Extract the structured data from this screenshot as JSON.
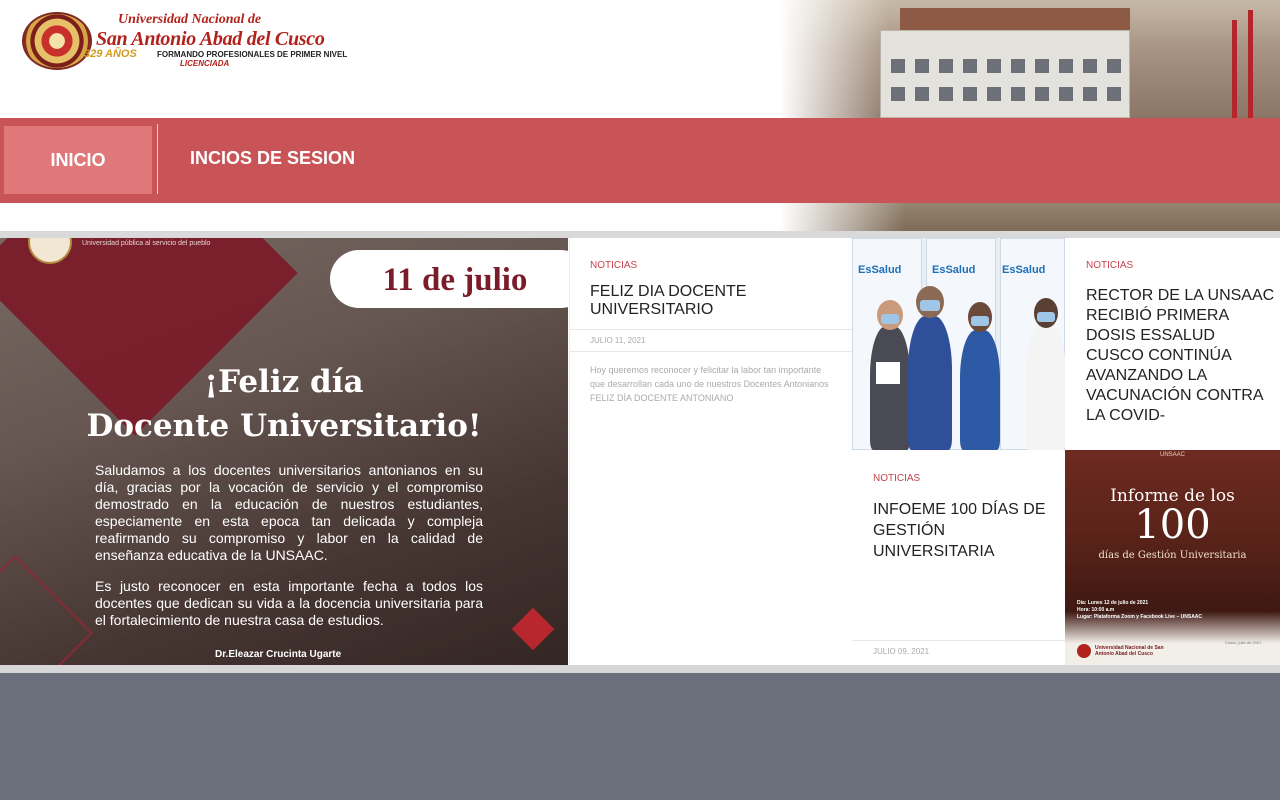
{
  "header": {
    "logo_line1": "Universidad Nacional de",
    "logo_line2": "San Antonio Abad del Cusco",
    "logo_years": "329 AÑOS",
    "logo_tagline": "FORMANDO PROFESIONALES DE PRIMER NIVEL",
    "logo_status": "LICENCIADA"
  },
  "nav": {
    "items": [
      {
        "label": "INICIO"
      },
      {
        "label": "INCIOS DE SESION"
      }
    ]
  },
  "poster": {
    "university_tag": "Universidad pública al servicio del pueblo",
    "date": "11 de julio",
    "heading_line1": "¡Feliz día",
    "heading_line2": "Docente Universitario!",
    "paragraph1": "Saludamos a los docentes universitarios antonianos en su día, gracias por la vocación de servicio y el compromiso demostrado en la educación de nuestros estudiantes, especiamente en esta epoca tan delicada y compleja reafirmando su compromiso y labor en la calidad de enseñanza educativa de la UNSAAC.",
    "paragraph2": "Es justo reconocer en esta importante fecha a todos los docentes que dedican su vida a la docencia universitaria para el fortalecimiento de nuestra casa de estudios.",
    "signature": "Dr.Eleazar Crucinta Ugarte"
  },
  "news": [
    {
      "category": "NOTICIAS",
      "title": "FELIZ DIA DOCENTE UNIVERSITARIO",
      "date": "JULIO 11, 2021",
      "excerpt": "Hoy queremos reconocer y felicitar la labor tan importante que desarrollan cada uno de nuestros Docentes Antonianos   FELIZ DÍA DOCENTE ANTONIANO"
    },
    {
      "category": "NOTICIAS",
      "title": "RECTOR DE LA UNSAAC RECIBIÓ PRIMERA DOSIS ESSALUD CUSCO CONTINÚA AVANZANDO LA VACUNACIÓN CONTRA LA COVID-"
    },
    {
      "category": "NOTICIAS",
      "title": "INFOEME 100 DÍAS DE GESTIÓN UNIVERSITARIA",
      "date": "JULIO 09, 2021"
    }
  ],
  "photo": {
    "banner_text": "EsSalud"
  },
  "informe": {
    "top": "UNSAAC",
    "title": "Informe de los",
    "number": "100",
    "subtitle": "días de Gestión Universitaria",
    "date_line": "Día: Lunes 12 de julio de 2021",
    "time_line": "Hora: 10:00 a.m",
    "place_line": "Lugar: Plataforma Zoom y Facebook Live – UNSAAC",
    "footer_name": "Universidad Nacional de San Antonio Abad del Cusco",
    "footer_date": "Cusco, julio de 2021"
  },
  "colors": {
    "nav_bg": "#c85457",
    "nav_active": "#e0787a",
    "category": "#c8434a",
    "page_bg": "#6b6f7c"
  }
}
